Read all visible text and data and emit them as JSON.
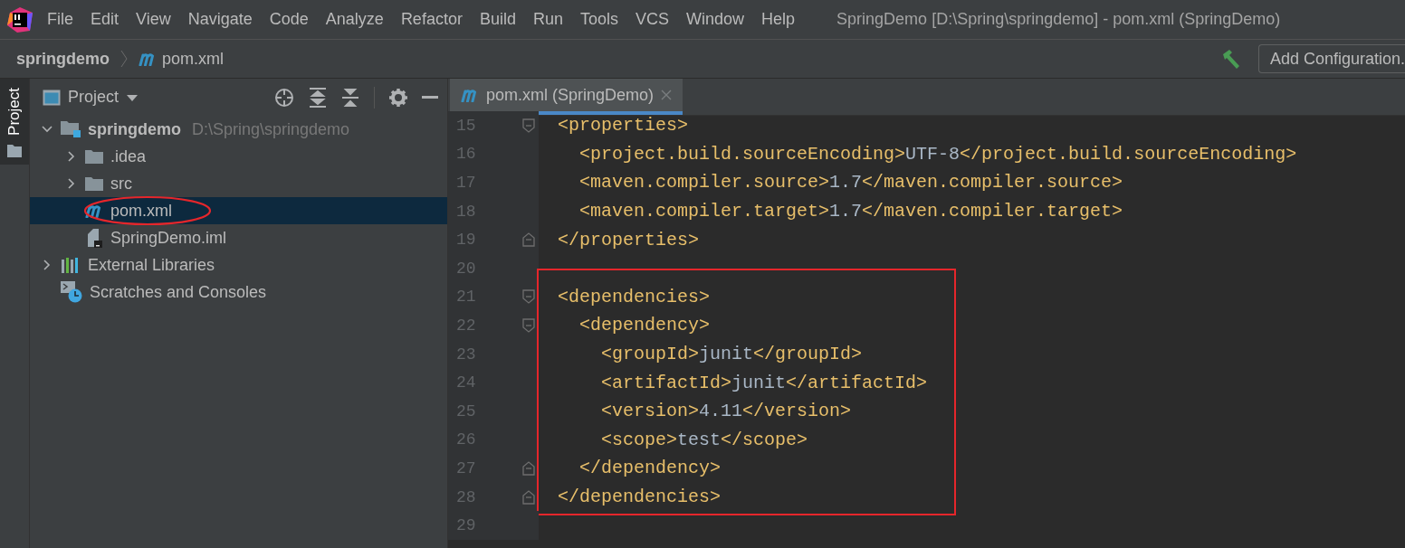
{
  "window": {
    "title": "SpringDemo [D:\\Spring\\springdemo] - pom.xml (SpringDemo)"
  },
  "menu": [
    {
      "label": "File"
    },
    {
      "label": "Edit"
    },
    {
      "label": "View"
    },
    {
      "label": "Navigate"
    },
    {
      "label": "Code"
    },
    {
      "label": "Analyze"
    },
    {
      "label": "Refactor"
    },
    {
      "label": "Build"
    },
    {
      "label": "Run"
    },
    {
      "label": "Tools"
    },
    {
      "label": "VCS"
    },
    {
      "label": "Window"
    },
    {
      "label": "Help"
    }
  ],
  "navbar": {
    "breadcrumbs": [
      {
        "label": "springdemo",
        "kind": "project"
      },
      {
        "label": "pom.xml",
        "kind": "maven"
      }
    ],
    "run_configuration": "Add Configuration."
  },
  "tool_strip": [
    {
      "label": "Project",
      "selected": true
    }
  ],
  "project_panel": {
    "title": "Project",
    "tree": [
      {
        "label": "springdemo",
        "path": "D:\\Spring\\springdemo",
        "kind": "module",
        "expanded": true,
        "selected": false,
        "circled": false,
        "children": [
          {
            "label": ".idea",
            "kind": "folder",
            "expanded": false,
            "selected": false,
            "circled": false
          },
          {
            "label": "src",
            "kind": "folder",
            "expanded": false,
            "selected": false,
            "circled": false
          },
          {
            "label": "pom.xml",
            "kind": "maven",
            "selected": true,
            "circled": true
          },
          {
            "label": "SpringDemo.iml",
            "kind": "iml",
            "selected": false,
            "circled": false
          }
        ]
      },
      {
        "label": "External Libraries",
        "kind": "libraries",
        "expanded": false,
        "selected": false,
        "circled": false
      },
      {
        "label": "Scratches and Consoles",
        "kind": "scratches",
        "selected": false,
        "circled": false
      }
    ]
  },
  "editor": {
    "tabs": [
      {
        "label": "pom.xml (SpringDemo)",
        "selected": true
      }
    ],
    "blocks": [
      {
        "boxed": false,
        "lines": [
          {
            "number": "15",
            "text": "<properties>",
            "fold_start": true,
            "fold_end": false
          },
          {
            "number": "16",
            "text": "  <project.build.sourceEncoding>UTF-8</project.build.sourceEncoding>",
            "fold_start": false,
            "fold_end": false
          },
          {
            "number": "17",
            "text": "  <maven.compiler.source>1.7</maven.compiler.source>",
            "fold_start": false,
            "fold_end": false
          },
          {
            "number": "18",
            "text": "  <maven.compiler.target>1.7</maven.compiler.target>",
            "fold_start": false,
            "fold_end": false
          },
          {
            "number": "19",
            "text": "</properties>",
            "fold_start": false,
            "fold_end": true
          },
          {
            "number": "20",
            "fold_start": false,
            "fold_end": false
          }
        ]
      },
      {
        "boxed": true,
        "lines": [
          {
            "number": "21",
            "text": "<dependencies>",
            "fold_start": true,
            "fold_end": false
          },
          {
            "number": "22",
            "text": "  <dependency>",
            "fold_start": true,
            "fold_end": false
          },
          {
            "number": "23",
            "text": "    <groupId>junit</groupId>",
            "fold_start": false,
            "fold_end": false
          },
          {
            "number": "24",
            "text": "    <artifactId>junit</artifactId>",
            "fold_start": false,
            "fold_end": false
          },
          {
            "number": "25",
            "text": "    <version>4.11</version>",
            "fold_start": false,
            "fold_end": false
          },
          {
            "number": "26",
            "text": "    <scope>test</scope>",
            "fold_start": false,
            "fold_end": false
          },
          {
            "number": "27",
            "text": "  </dependency>",
            "fold_start": false,
            "fold_end": true
          },
          {
            "number": "28",
            "text": "</dependencies>",
            "fold_start": false,
            "fold_end": true
          }
        ]
      },
      {
        "boxed": false,
        "lines": [
          {
            "number": "29",
            "fold_start": false,
            "fold_end": false
          }
        ]
      }
    ]
  }
}
